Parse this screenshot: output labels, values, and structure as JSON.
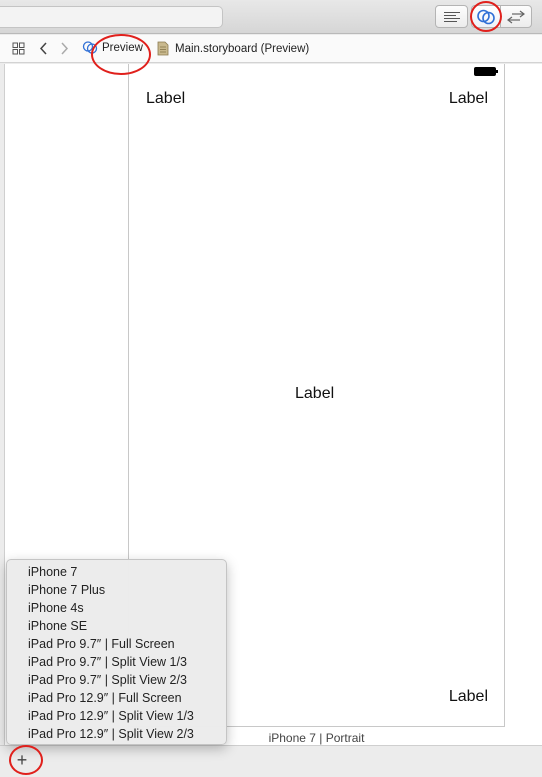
{
  "jumpbar": {
    "preview_label": "Preview",
    "file_label": "Main.storyboard (Preview)"
  },
  "device": {
    "labels": {
      "top_left": "Label",
      "top_right": "Label",
      "center": "Label",
      "bottom_right": "Label"
    },
    "caption": "iPhone 7 | Portrait"
  },
  "menu": {
    "items": [
      "iPhone 7",
      "iPhone 7 Plus",
      "iPhone 4s",
      "iPhone SE",
      "iPad Pro 9.7″ | Full Screen",
      "iPad Pro 9.7″ | Split View 1/3",
      "iPad Pro 9.7″ | Split View 2/3",
      "iPad Pro 12.9″ | Full Screen",
      "iPad Pro 12.9″ | Split View 1/3",
      "iPad Pro 12.9″ | Split View 2/3"
    ]
  },
  "bottombar": {
    "add_label": "+"
  },
  "colors": {
    "annotation": "#e0201c",
    "accent": "#2f6fd6"
  },
  "icons": {
    "toolbar": [
      "standard-editor-icon",
      "assistant-editor-icon",
      "version-editor-icon"
    ],
    "jumpbar": [
      "related-items-icon",
      "back-icon",
      "forward-icon",
      "preview-icon",
      "storyboard-file-icon"
    ],
    "device": [
      "battery-icon"
    ]
  }
}
